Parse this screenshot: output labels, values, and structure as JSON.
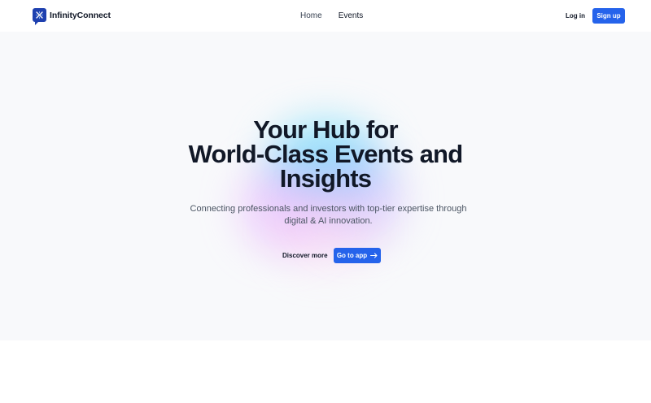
{
  "brand": {
    "name": "InfinityConnect",
    "logo_icon": "infinity-logo-icon",
    "accent": "#2563eb"
  },
  "nav": {
    "items": [
      {
        "label": "Home"
      },
      {
        "label": "Events"
      }
    ]
  },
  "auth": {
    "login": "Log in",
    "signup": "Sign up"
  },
  "hero": {
    "title_line1": "Your Hub for",
    "title_line2": "World-Class Events and",
    "title_line3": "Insights",
    "subtitle_line1": "Connecting professionals and investors with top-tier expertise through",
    "subtitle_line2": "digital & AI innovation.",
    "cta_secondary": "Discover more",
    "cta_primary": "Go to app",
    "cta_primary_icon": "arrow-right-icon"
  }
}
